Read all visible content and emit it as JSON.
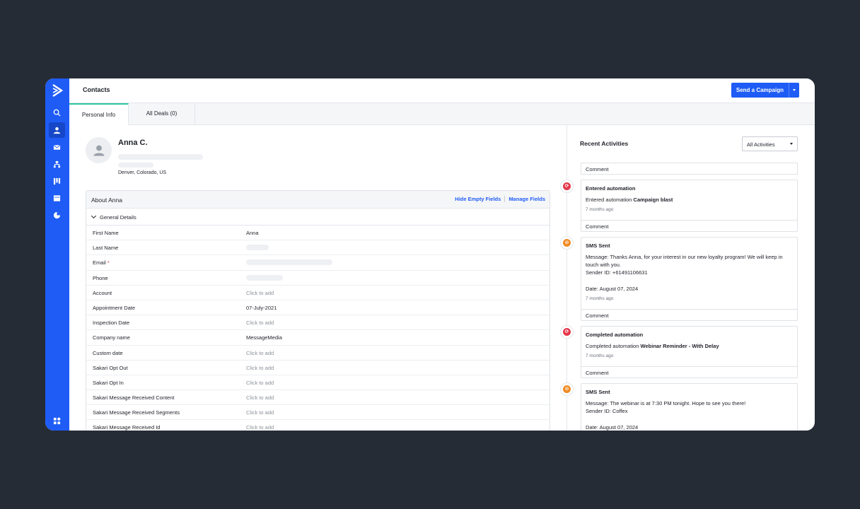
{
  "header": {
    "title": "Contacts",
    "send_button": "Send a Campaign"
  },
  "tabs": [
    {
      "label": "Personal Info",
      "active": true
    },
    {
      "label": "All Deals (0)",
      "active": false
    }
  ],
  "contact": {
    "name": "Anna C.",
    "location": "Denver, Colorado, US"
  },
  "about": {
    "title": "About Anna",
    "hide_empty": "Hide Empty Fields",
    "manage_fields": "Manage Fields",
    "section": "General Details",
    "fields": [
      {
        "label": "First Name",
        "value": "Anna"
      },
      {
        "label": "Last Name",
        "value": ""
      },
      {
        "label": "Email",
        "value": ""
      },
      {
        "label": "Phone",
        "value": ""
      },
      {
        "label": "Account",
        "value": "Click to add"
      },
      {
        "label": "Appointment Date",
        "value": "07-July-2021"
      },
      {
        "label": "Inspection Date",
        "value": "Click to add"
      },
      {
        "label": "Company name",
        "value": "MessageMedia"
      },
      {
        "label": "Custom date",
        "value": "Click to add"
      },
      {
        "label": "Sakari Opt Out",
        "value": "Click to add"
      },
      {
        "label": "Sakari Opt In",
        "value": "Click to add"
      },
      {
        "label": "Sakari Message Received Content",
        "value": "Click to add"
      },
      {
        "label": "Sakari Message Received Segments",
        "value": "Click to add"
      },
      {
        "label": "Sakari Message Received Id",
        "value": "Click to add"
      }
    ],
    "required_mark": "*"
  },
  "activities": {
    "title": "Recent Activities",
    "filter": "All Activities",
    "comment_label": "Comment",
    "items": [
      {
        "title": "Entered automation",
        "body_prefix": "Entered automation ",
        "body_bold": "Campaign blast",
        "time": "7 months ago",
        "color": "#e5374a"
      },
      {
        "title": "SMS Sent",
        "line1": "Message: Thanks Anna, for your interest in our new loyalty program! We will keep in touch with you.",
        "line2": "Sender ID: +61491106631",
        "line3": "Date: August 07, 2024",
        "time": "7 months ago",
        "color": "#f08a24"
      },
      {
        "title": "Completed automation",
        "body_prefix": "Completed automation ",
        "body_bold": "Webinar Reminder - With Delay",
        "time": "7 months ago",
        "color": "#e5374a"
      },
      {
        "title": "SMS Sent",
        "line1": "Message: The webinar is at 7:30 PM tonight. Hope to see you there!",
        "line2": "Sender ID: Coffex",
        "line3": "Date: August 07, 2024",
        "color": "#f08a24"
      }
    ]
  }
}
